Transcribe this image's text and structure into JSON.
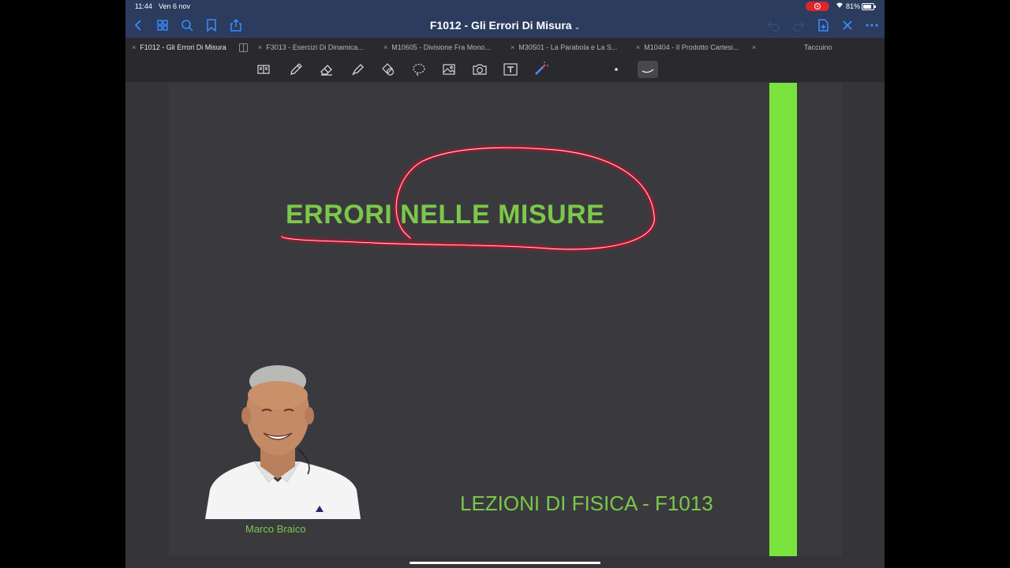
{
  "status_bar": {
    "time": "11:44",
    "date": "Ven 6 nov",
    "battery": "81%"
  },
  "nav": {
    "title": "F1012 - Gli Errori Di Misura",
    "title_chevron": "⌄"
  },
  "tabs": [
    {
      "label": "F1012 - Gli Errori Di Misura",
      "active": true
    },
    {
      "label": "F3013 - Esercizi Di Dinamica...",
      "active": false
    },
    {
      "label": "M10605 - Divisione Fra Mono...",
      "active": false
    },
    {
      "label": "M30501 - La Parabola e La S...",
      "active": false
    },
    {
      "label": "M10404 - Il Prodotto  Cartesi...",
      "active": false
    }
  ],
  "tab_close": "×",
  "notebook_label": "Taccuino",
  "page": {
    "heading": "ERRORI NELLE MISURE",
    "subtitle": "LEZIONI DI FISICA - F1013",
    "author": "Marco Braico"
  },
  "colors": {
    "accent": "#3b8cff",
    "nav_bg": "#2b3c5e",
    "text_green": "#7cc84a",
    "strip_green": "#7be33e",
    "ink_red": "#e0102a",
    "record_red": "#e0242b"
  },
  "icons": {
    "nav_left": [
      "back-icon",
      "grid-icon",
      "search-icon",
      "bookmark-icon",
      "share-icon"
    ],
    "nav_right": [
      "undo-icon",
      "redo-icon",
      "add-page-icon",
      "close-icon",
      "more-icon"
    ],
    "tools": [
      "read-mode-icon",
      "pen-icon",
      "eraser-icon",
      "highlighter-icon",
      "shapes-icon",
      "lasso-icon",
      "image-icon",
      "camera-icon",
      "text-icon",
      "laser-pointer-icon",
      "dot-size-icon",
      "stroke-icon"
    ]
  }
}
